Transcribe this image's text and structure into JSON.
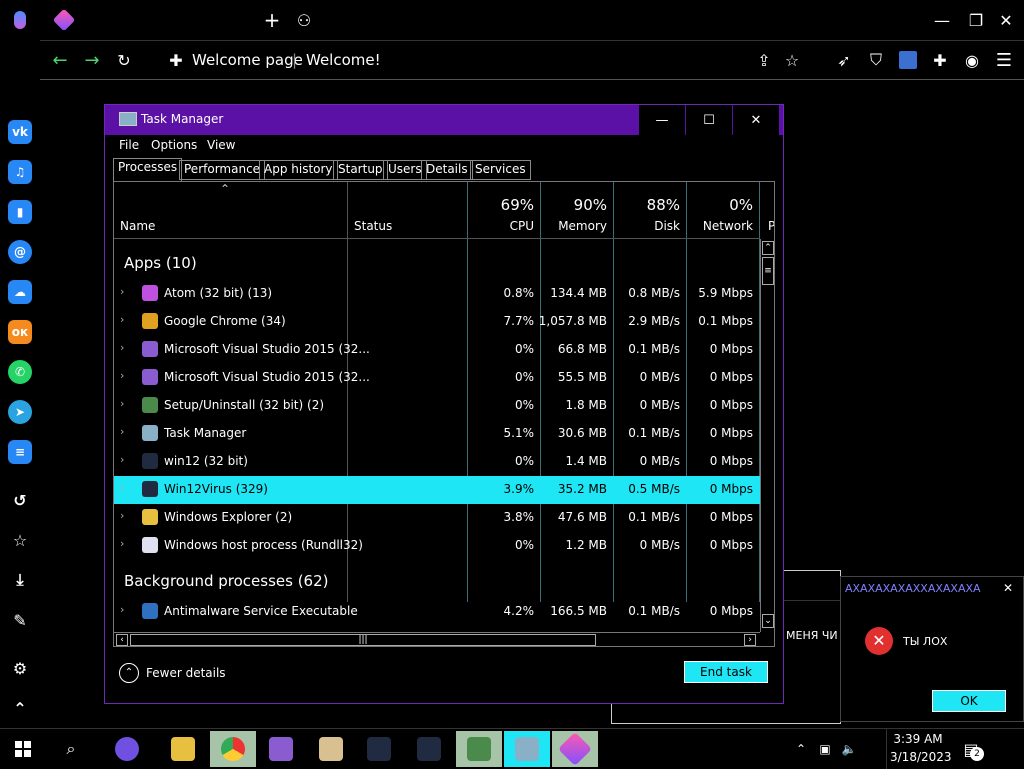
{
  "browser": {
    "tab_title": "Welcome page",
    "page_title": "Welcome!",
    "colors": {
      "accent": "#4ad66d",
      "border": "#555555"
    }
  },
  "task_manager": {
    "title": "Task Manager",
    "menu": [
      "File",
      "Options",
      "View"
    ],
    "tabs": [
      "Processes",
      "Performance",
      "App history",
      "Startup",
      "Users",
      "Details",
      "Services"
    ],
    "columns": {
      "name": "Name",
      "status": "Status",
      "cpu": {
        "pct": "69%",
        "label": "CPU"
      },
      "memory": {
        "pct": "90%",
        "label": "Memory"
      },
      "disk": {
        "pct": "88%",
        "label": "Disk"
      },
      "network": {
        "pct": "0%",
        "label": "Network"
      },
      "power_partial": "P"
    },
    "groups": {
      "apps": "Apps (10)",
      "background": "Background processes (62)"
    },
    "apps": [
      {
        "name": "Atom (32 bit) (13)",
        "cpu": "0.8%",
        "memory": "134.4 MB",
        "disk": "0.8 MB/s",
        "network": "5.9 Mbps",
        "icon": "atom-icon",
        "color": "#c050e0"
      },
      {
        "name": "Google Chrome (34)",
        "cpu": "7.7%",
        "memory": "1,057.8 MB",
        "disk": "2.9 MB/s",
        "network": "0.1 Mbps",
        "icon": "chrome-icon",
        "color": "#e0a020"
      },
      {
        "name": "Microsoft Visual Studio 2015 (32...",
        "cpu": "0%",
        "memory": "66.8 MB",
        "disk": "0.1 MB/s",
        "network": "0 Mbps",
        "icon": "visual-studio-icon",
        "color": "#8a5cd0"
      },
      {
        "name": "Microsoft Visual Studio 2015 (32...",
        "cpu": "0%",
        "memory": "55.5 MB",
        "disk": "0 MB/s",
        "network": "0 Mbps",
        "icon": "visual-studio-icon",
        "color": "#8a5cd0"
      },
      {
        "name": "Setup/Uninstall (32 bit) (2)",
        "cpu": "0%",
        "memory": "1.8 MB",
        "disk": "0 MB/s",
        "network": "0 Mbps",
        "icon": "setup-icon",
        "color": "#4a8a4a"
      },
      {
        "name": "Task Manager",
        "cpu": "5.1%",
        "memory": "30.6 MB",
        "disk": "0.1 MB/s",
        "network": "0 Mbps",
        "icon": "task-manager-icon",
        "color": "#8ab0c8"
      },
      {
        "name": "win12 (32 bit)",
        "cpu": "0%",
        "memory": "1.4 MB",
        "disk": "0 MB/s",
        "network": "0 Mbps",
        "icon": "win12-icon",
        "color": "#202a40"
      },
      {
        "name": "Win12Virus (329)",
        "cpu": "3.9%",
        "memory": "35.2 MB",
        "disk": "0.5 MB/s",
        "network": "0 Mbps",
        "icon": "win12virus-icon",
        "color": "#202a40"
      },
      {
        "name": "Windows Explorer (2)",
        "cpu": "3.8%",
        "memory": "47.6 MB",
        "disk": "0.1 MB/s",
        "network": "0 Mbps",
        "icon": "explorer-icon",
        "color": "#e8c040"
      },
      {
        "name": "Windows host process (Rundll32)",
        "cpu": "0%",
        "memory": "1.2 MB",
        "disk": "0 MB/s",
        "network": "0 Mbps",
        "icon": "file-icon",
        "color": "#e0e0f0"
      }
    ],
    "background": [
      {
        "name": "Antimalware Service Executable",
        "cpu": "4.2%",
        "memory": "166.5 MB",
        "disk": "0.1 MB/s",
        "network": "0 Mbps",
        "icon": "antimalware-icon",
        "color": "#3070c0"
      }
    ],
    "selected_index": 7,
    "fewer_details": "Fewer details",
    "end_task": "End task",
    "window_buttons": {
      "minimize": "—",
      "maximize": "☐",
      "close": "✕"
    }
  },
  "behind_window": {
    "text": "МЕНЯ ЧИ"
  },
  "popup": {
    "title": "АХАХАХАХАХХАХАХАХА",
    "message": "ТЫ ЛОХ",
    "ok": "OK"
  },
  "taskbar": {
    "time": "3:39 AM",
    "date": "3/18/2023",
    "notifications": "2"
  }
}
